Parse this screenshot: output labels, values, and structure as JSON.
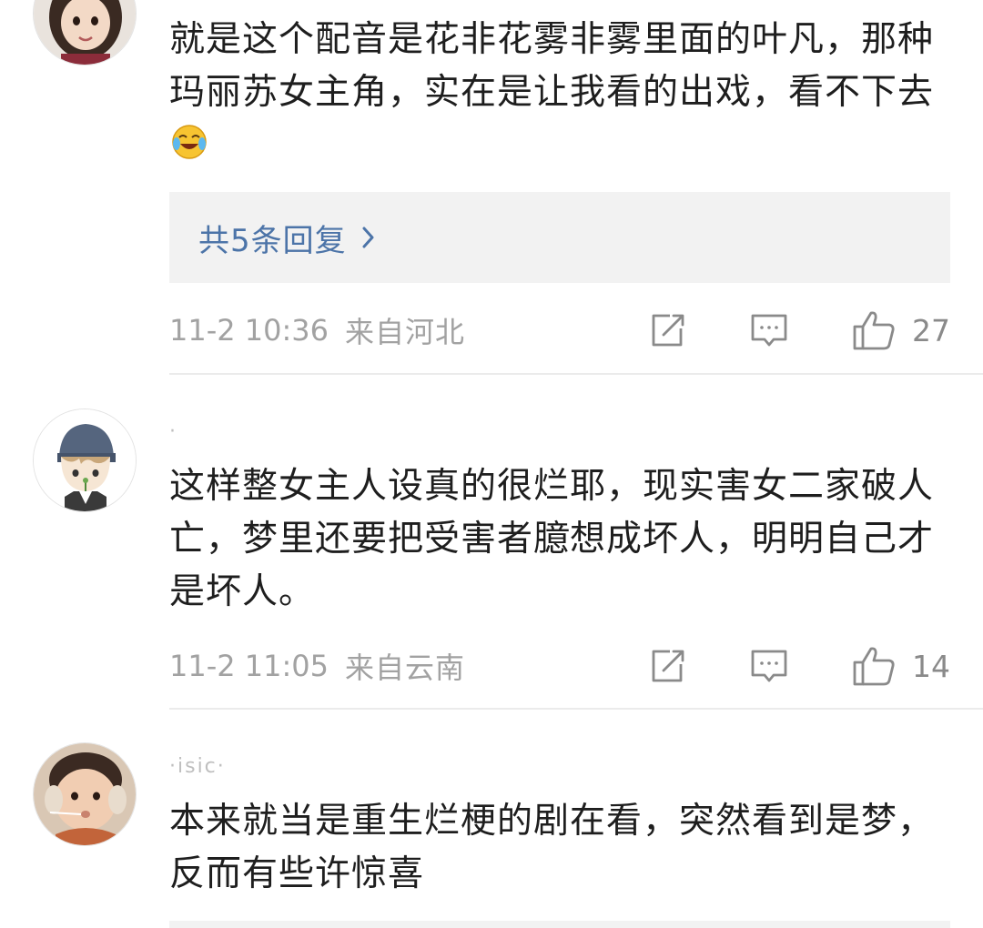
{
  "comments": [
    {
      "username": "",
      "text": "就是这个配音是花非花雾非雾里面的叶凡，那种玛丽苏女主角，实在是让我看的出戏，看不下去",
      "emoji": "laugh-cry-emoji",
      "replies_label": "共5条回复",
      "time": "11-2 10:36",
      "location": "来自河北",
      "likes": "27"
    },
    {
      "username": "·",
      "text": "这样整女主人设真的很烂耶，现实害女二家破人亡，梦里还要把受害者臆想成坏人，明明自己才是坏人。",
      "time": "11-2 11:05",
      "location": "来自云南",
      "likes": "14"
    },
    {
      "username": "·isic·",
      "text": "本来就当是重生烂梗的剧在看，突然看到是梦，反而有些许惊喜"
    }
  ],
  "icons": {
    "share": "share-edit-icon",
    "comment": "comment-bubble-icon",
    "like": "thumbs-up-icon",
    "chevron": "chevron-right-icon"
  },
  "colors": {
    "link": "#4c74a8",
    "meta": "#a2a2a2",
    "reply_bg": "#f2f2f2"
  }
}
